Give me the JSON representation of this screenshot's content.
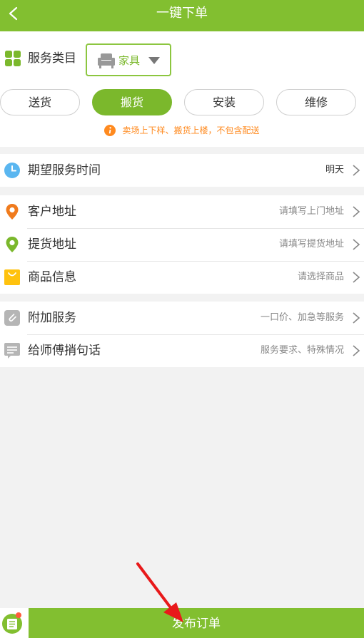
{
  "header": {
    "title": "一键下单"
  },
  "category": {
    "label": "服务类目",
    "selected": "家具"
  },
  "service_types": [
    {
      "label": "送货",
      "active": false
    },
    {
      "label": "搬货",
      "active": true
    },
    {
      "label": "安装",
      "active": false
    },
    {
      "label": "维修",
      "active": false
    }
  ],
  "notice": {
    "text": "卖场上下样、搬货上楼，不包含配送"
  },
  "rows": {
    "time": {
      "label": "期望服务时间",
      "value": "明天"
    },
    "customer_address": {
      "label": "客户地址",
      "placeholder": "请填写上门地址"
    },
    "pickup_address": {
      "label": "提货地址",
      "placeholder": "请填写提货地址"
    },
    "goods": {
      "label": "商品信息",
      "placeholder": "请选择商品"
    },
    "extra": {
      "label": "附加服务",
      "placeholder": "一口价、加急等服务"
    },
    "note": {
      "label": "给师傅捎句话",
      "placeholder": "服务要求、特殊情况"
    }
  },
  "footer": {
    "submit_label": "发布订单"
  },
  "colors": {
    "brand": "#82bf30",
    "accent_orange": "#ff8a1f",
    "annotation_arrow": "#e8191a"
  }
}
